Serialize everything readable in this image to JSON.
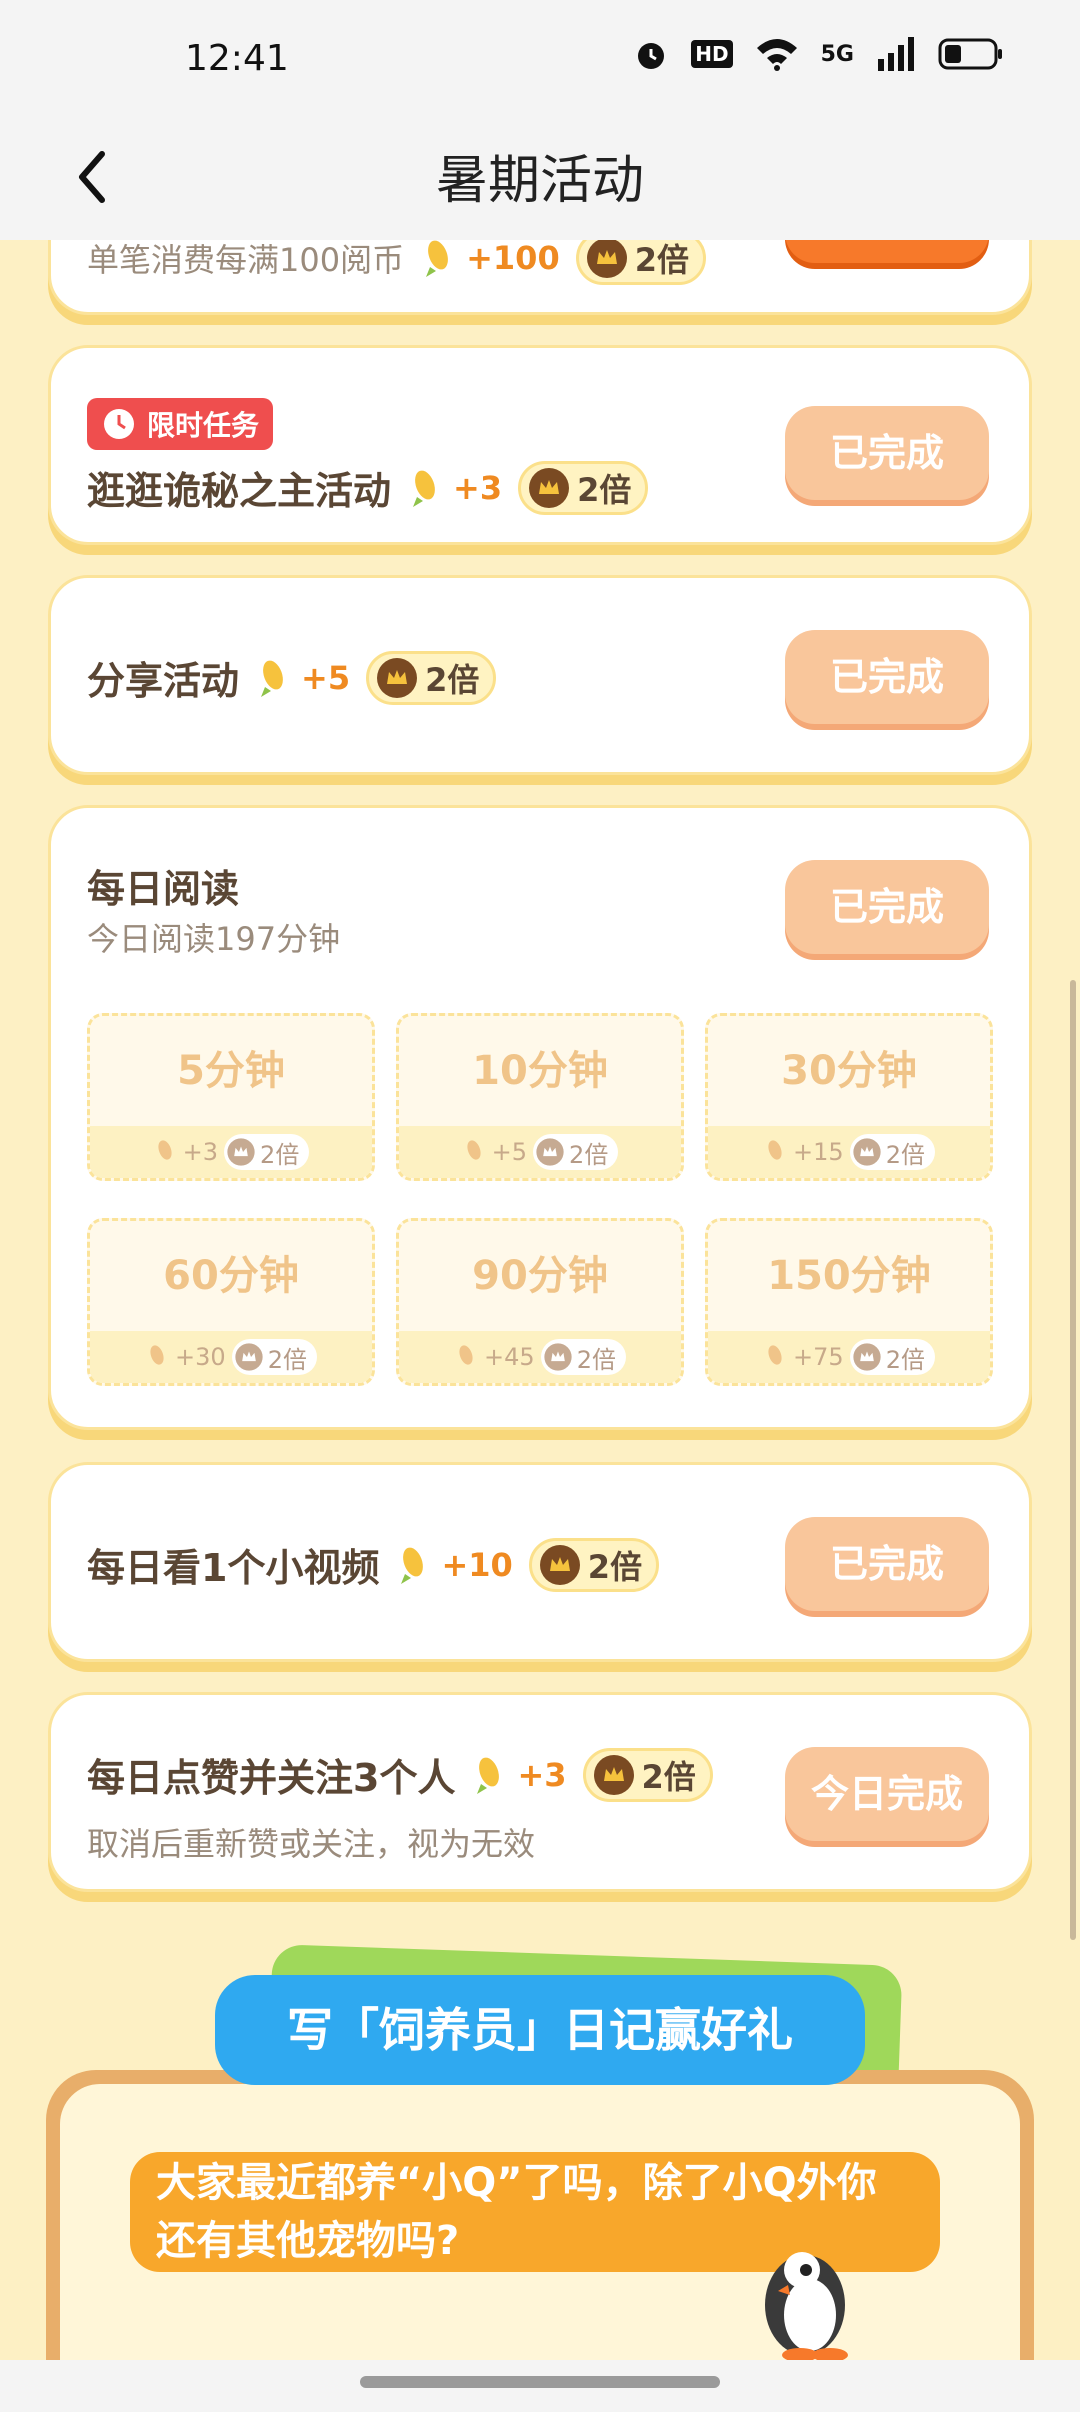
{
  "status_bar": {
    "time": "12:41",
    "hd": "HD",
    "network": "5G"
  },
  "header": {
    "title": "暑期活动"
  },
  "tasks": [
    {
      "title": "单笔消费每满100阅币",
      "plus": "+100",
      "mult": "2倍"
    },
    {
      "badge": "限时任务",
      "title": "逛逛诡秘之主活动",
      "plus": "+3",
      "mult": "2倍",
      "button": "已完成"
    },
    {
      "title": "分享活动",
      "plus": "+5",
      "mult": "2倍",
      "button": "已完成"
    },
    {
      "title": "每日阅读",
      "subtitle": "今日阅读197分钟",
      "button": "已完成",
      "tiles": [
        {
          "label": "5分钟",
          "plus": "+3",
          "mult": "2倍"
        },
        {
          "label": "10分钟",
          "plus": "+5",
          "mult": "2倍"
        },
        {
          "label": "30分钟",
          "plus": "+15",
          "mult": "2倍"
        },
        {
          "label": "60分钟",
          "plus": "+30",
          "mult": "2倍"
        },
        {
          "label": "90分钟",
          "plus": "+45",
          "mult": "2倍"
        },
        {
          "label": "150分钟",
          "plus": "+75",
          "mult": "2倍"
        }
      ]
    },
    {
      "title": "每日看1个小视频",
      "plus": "+10",
      "mult": "2倍",
      "button": "已完成"
    },
    {
      "title": "每日点赞并关注3个人",
      "plus": "+3",
      "mult": "2倍",
      "subtitle": "取消后重新赞或关注，视为无效",
      "button": "今日完成"
    }
  ],
  "banner": {
    "title": "写「饲养员」日记赢好礼",
    "question_line1": "大家最近都养“小Q”了吗，除了小Q外你",
    "question_line2": "还有其他宠物吗?"
  },
  "colors": {
    "accent": "#f7792a",
    "done_button": "#f9c69b",
    "banner_blue": "#2fa9f0",
    "badge_red": "#ef4e4e"
  }
}
